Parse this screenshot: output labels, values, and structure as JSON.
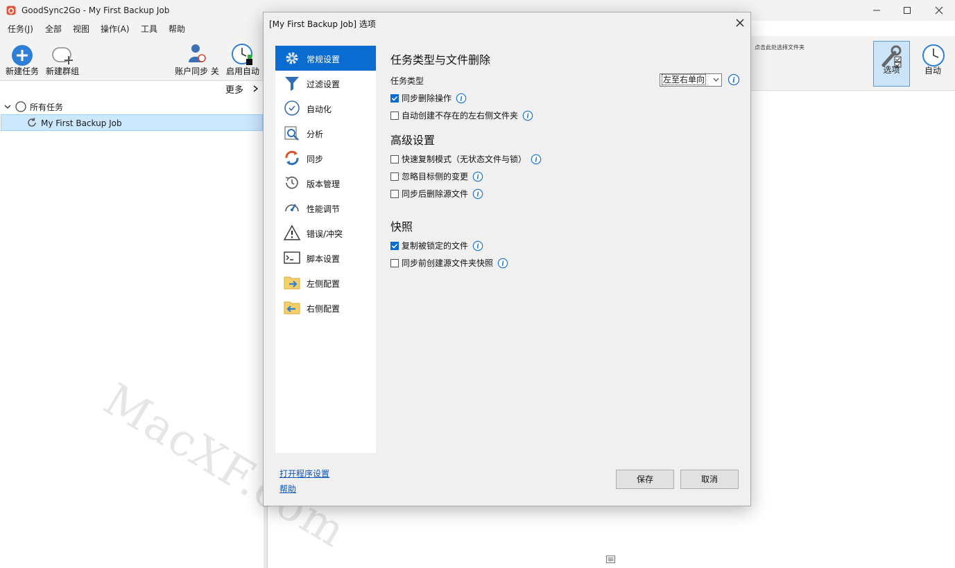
{
  "window": {
    "title": "GoodSync2Go - My First Backup Job"
  },
  "menu": [
    "任务(J)",
    "全部",
    "视图",
    "操作(A)",
    "工具",
    "帮助"
  ],
  "toolbar": {
    "new_job": "新建任务",
    "new_group": "新建群组",
    "account_sync": "账户同步 关",
    "enable_auto": "启用自动",
    "more": "更多"
  },
  "right_toolbar": {
    "hint": "点击此处选择文件夹",
    "options": "选项",
    "auto": "自动"
  },
  "tree": {
    "root": "所有任务",
    "job": "My First Backup Job"
  },
  "dialog": {
    "title": "[My First Backup Job] 选项",
    "nav": [
      "常规设置",
      "过滤设置",
      "自动化",
      "分析",
      "同步",
      "版本管理",
      "性能调节",
      "错误/冲突",
      "脚本设置",
      "左侧配置",
      "右侧配置"
    ],
    "nav_icons": [
      "gear-icon",
      "filter-icon",
      "clock-icon",
      "analyze-icon",
      "sync-icon",
      "history-icon",
      "gauge-icon",
      "warning-icon",
      "terminal-icon",
      "left-folder-icon",
      "right-folder-icon"
    ],
    "selected_nav": 0,
    "section1": "任务类型与文件删除",
    "job_type_label": "任务类型",
    "job_type_value": "左至右单向",
    "opt_propagate_deletions": "同步删除操作",
    "opt_autocreate": "自动创建不存在的左右侧文件夹",
    "section2": "高级设置",
    "opt_fast_copy": "快速复制模式（无状态文件与锁）",
    "opt_ignore_dest": "忽略目标侧的变更",
    "opt_delete_after": "同步后删除源文件",
    "section3": "快照",
    "opt_copy_locked": "复制被锁定的文件",
    "opt_snapshot": "同步前创建源文件夹快照",
    "checked": {
      "propagate_deletions": true,
      "autocreate": false,
      "fast_copy": false,
      "ignore_dest": false,
      "delete_after": false,
      "copy_locked": true,
      "snapshot": false
    },
    "link_program_options": "打开程序设置",
    "link_help": "帮助",
    "save": "保存",
    "cancel": "取消"
  },
  "watermark": "MacXF.com",
  "colors": {
    "accent": "#0a6cd0",
    "selection": "#cce8ff",
    "info": "#1a73c9"
  }
}
